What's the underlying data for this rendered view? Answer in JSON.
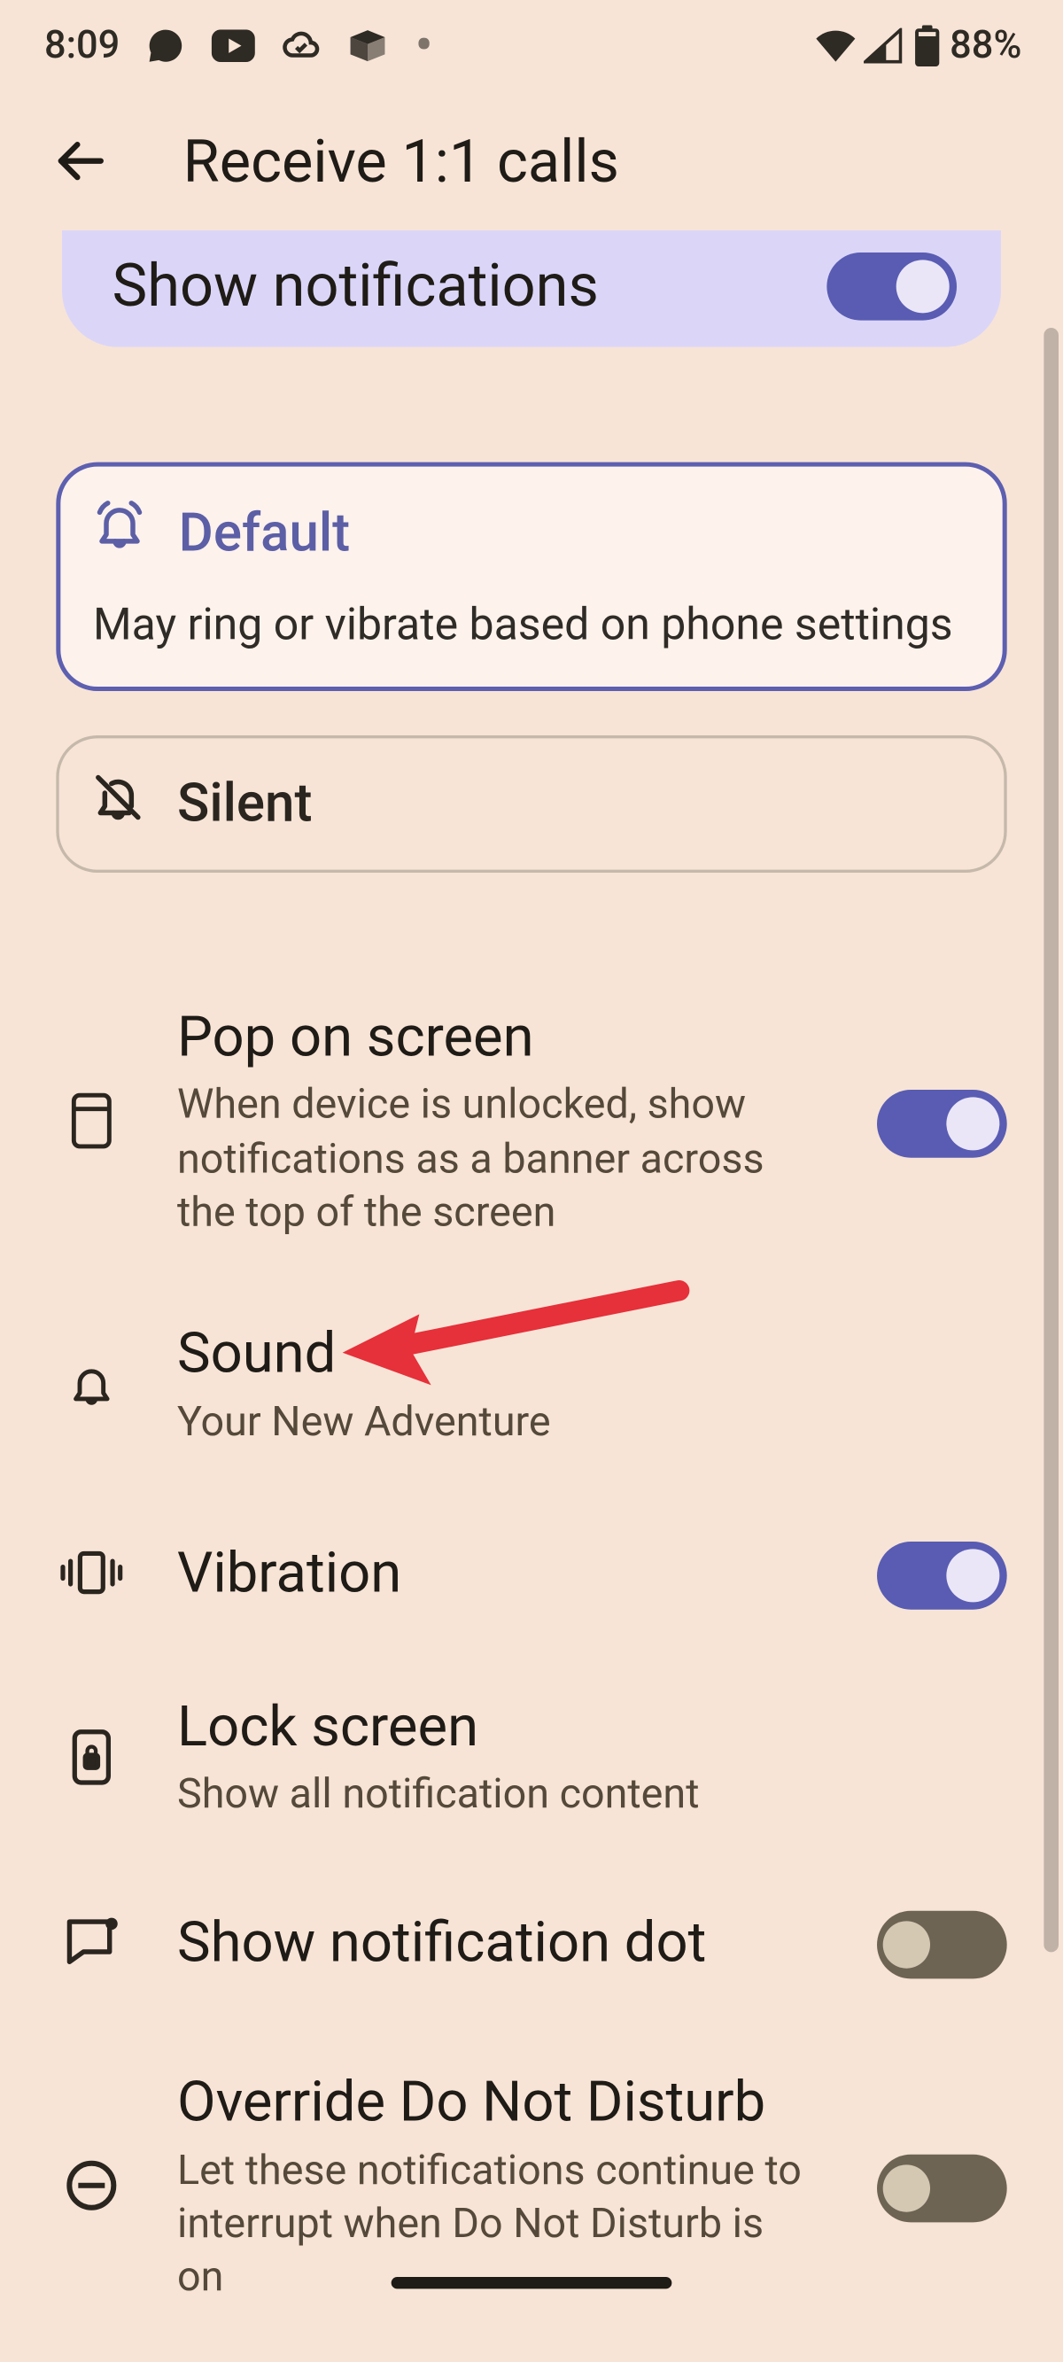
{
  "status": {
    "time": "8:09",
    "battery": "88%"
  },
  "header": {
    "title": "Receive 1:1 calls"
  },
  "show_notifications": {
    "label": "Show notifications",
    "enabled": true
  },
  "modes": {
    "default": {
      "label": "Default",
      "desc": "May ring or vibrate based on phone settings"
    },
    "silent": {
      "label": "Silent"
    }
  },
  "rows": {
    "pop": {
      "title": "Pop on screen",
      "sub": "When device is unlocked, show notifications as a banner across the top of the screen",
      "on": true
    },
    "sound": {
      "title": "Sound",
      "sub": "Your New Adventure"
    },
    "vibration": {
      "title": "Vibration",
      "on": true
    },
    "lockscreen": {
      "title": "Lock screen",
      "sub": "Show all notification content"
    },
    "dot": {
      "title": "Show notification dot",
      "on": false
    },
    "dnd": {
      "title": "Override Do Not Disturb",
      "sub": "Let these notifications continue to interrupt when Do Not Disturb is on",
      "on": false
    }
  }
}
